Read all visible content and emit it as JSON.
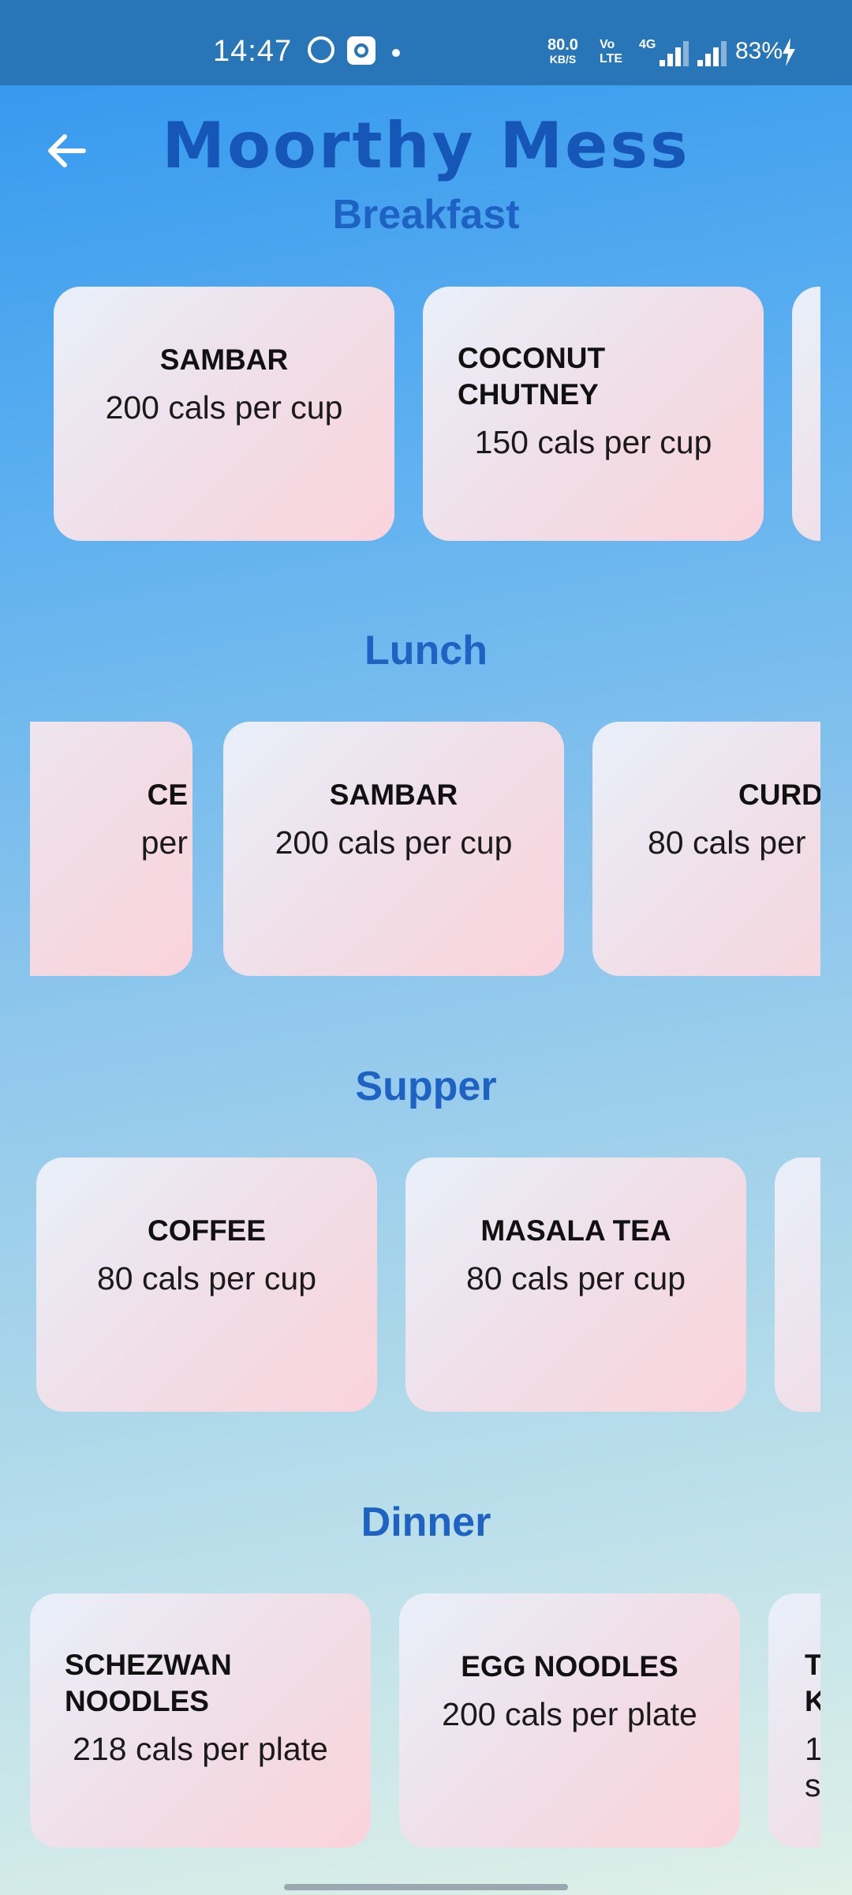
{
  "status_bar": {
    "time": "14:47",
    "speed_value": "80.0",
    "speed_unit": "KB/S",
    "volte_top": "Vo",
    "volte_bottom": "LTE",
    "network": "4G",
    "battery": "83%"
  },
  "header": {
    "title": "Moorthy Mess",
    "back_icon": "arrow-left-icon"
  },
  "sections": {
    "breakfast": {
      "title": "Breakfast",
      "items": [
        {
          "name": "SAMBAR",
          "cal": "200 cals per cup"
        },
        {
          "name": "COCONUT CHUTNEY",
          "cal": "150 cals per cup"
        },
        {
          "name": "",
          "cal": ""
        }
      ]
    },
    "lunch": {
      "title": "Lunch",
      "items": [
        {
          "name": "CE",
          "cal": "per"
        },
        {
          "name": "SAMBAR",
          "cal": "200 cals per cup"
        },
        {
          "name": "CURD",
          "cal": "80 cals per"
        }
      ]
    },
    "supper": {
      "title": "Supper",
      "items": [
        {
          "name": "COFFEE",
          "cal": "80 cals per cup"
        },
        {
          "name": "MASALA TEA",
          "cal": "80 cals per cup"
        },
        {
          "name": "",
          "cal": ""
        }
      ]
    },
    "dinner": {
      "title": "Dinner",
      "items": [
        {
          "name": "SCHEZWAN NOODLES",
          "cal": "218 cals per plate"
        },
        {
          "name": "EGG NOODLES",
          "cal": "200 cals per plate"
        },
        {
          "name": "T K",
          "cal": "1 s"
        }
      ]
    }
  },
  "colors": {
    "title": "#1656b7",
    "section_title": "#1e63c4",
    "status_bar": "#2876b8",
    "card_start": "#e8f0fa",
    "card_end": "#fbd3db"
  }
}
